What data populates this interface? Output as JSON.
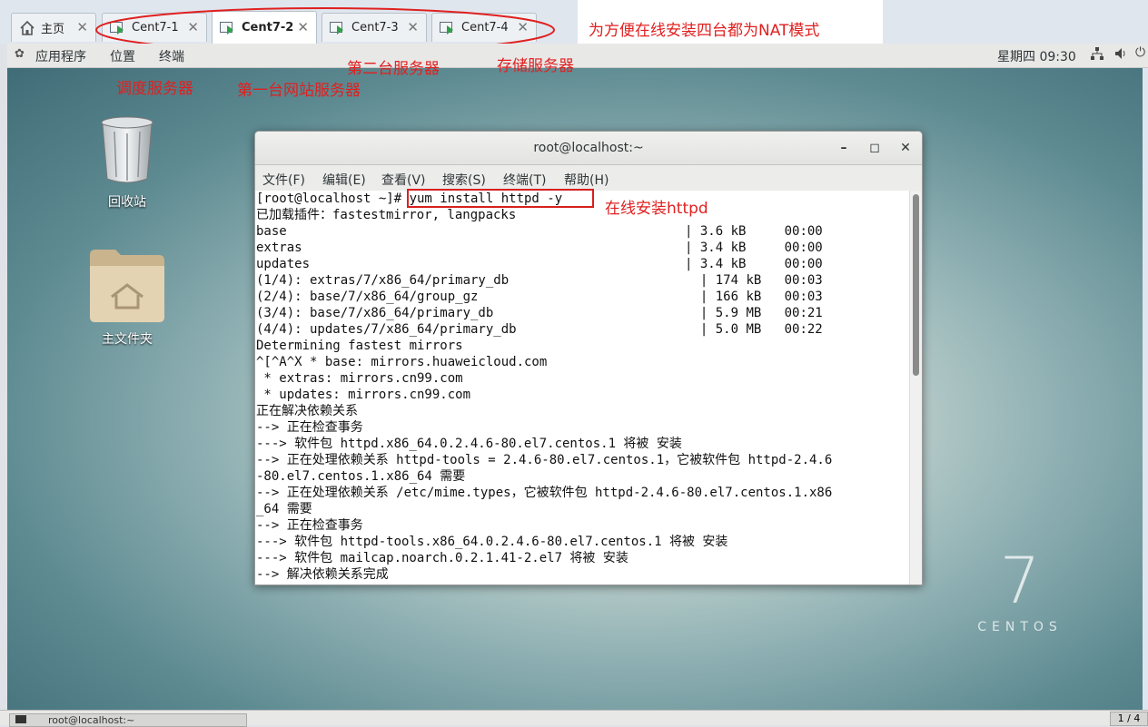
{
  "tabs": [
    {
      "label": "主页",
      "icon": "home-icon"
    },
    {
      "label": "Cent7-1",
      "icon": "vm-icon"
    },
    {
      "label": "Cent7-2",
      "icon": "vm-icon",
      "active": true
    },
    {
      "label": "Cent7-3",
      "icon": "vm-icon"
    },
    {
      "label": "Cent7-4",
      "icon": "vm-icon"
    }
  ],
  "annotations": {
    "top_note": "为方便在线安装四台都为NAT模式",
    "second_server": "第二台服务器",
    "storage_server": "存储服务器",
    "scheduler_server": "调度服务器",
    "first_web_server": "第一台网站服务器",
    "install_note": "在线安装httpd"
  },
  "topbar": {
    "applications": "应用程序",
    "places": "位置",
    "terminal": "终端",
    "clock": "星期四 09:30"
  },
  "desktop": {
    "trash_label": "回收站",
    "home_folder_label": "主文件夹",
    "watermark_number": "7",
    "watermark_text": "CENTOS"
  },
  "terminal": {
    "title": "root@localhost:~",
    "menu": [
      "文件(F)",
      "编辑(E)",
      "查看(V)",
      "搜索(S)",
      "终端(T)",
      "帮助(H)"
    ],
    "lines": [
      "[root@localhost ~]# yum install httpd -y",
      "已加载插件：fastestmirror, langpacks",
      "base                                                    | 3.6 kB     00:00",
      "extras                                                  | 3.4 kB     00:00",
      "updates                                                 | 3.4 kB     00:00",
      "(1/4): extras/7/x86_64/primary_db                         | 174 kB   00:03",
      "(2/4): base/7/x86_64/group_gz                             | 166 kB   00:03",
      "(3/4): base/7/x86_64/primary_db                           | 5.9 MB   00:21",
      "(4/4): updates/7/x86_64/primary_db                        | 5.0 MB   00:22",
      "Determining fastest mirrors",
      "^[^A^X * base: mirrors.huaweicloud.com",
      " * extras: mirrors.cn99.com",
      " * updates: mirrors.cn99.com",
      "正在解决依赖关系",
      "--> 正在检查事务",
      "---> 软件包 httpd.x86_64.0.2.4.6-80.el7.centos.1 将被 安装",
      "--> 正在处理依赖关系 httpd-tools = 2.4.6-80.el7.centos.1，它被软件包 httpd-2.4.6",
      "-80.el7.centos.1.x86_64 需要",
      "--> 正在处理依赖关系 /etc/mime.types，它被软件包 httpd-2.4.6-80.el7.centos.1.x86",
      "_64 需要",
      "--> 正在检查事务",
      "---> 软件包 httpd-tools.x86_64.0.2.4.6-80.el7.centos.1 将被 安装",
      "---> 软件包 mailcap.noarch.0.2.1.41-2.el7 将被 安装",
      "--> 解决依赖关系完成"
    ]
  },
  "taskbar": {
    "item": "root@localhost:~",
    "pager": "1 / 4"
  },
  "colors": {
    "annotation": "#e02020",
    "desktop_center": "#e9efe8",
    "desktop_edge": "#3f6c76"
  }
}
